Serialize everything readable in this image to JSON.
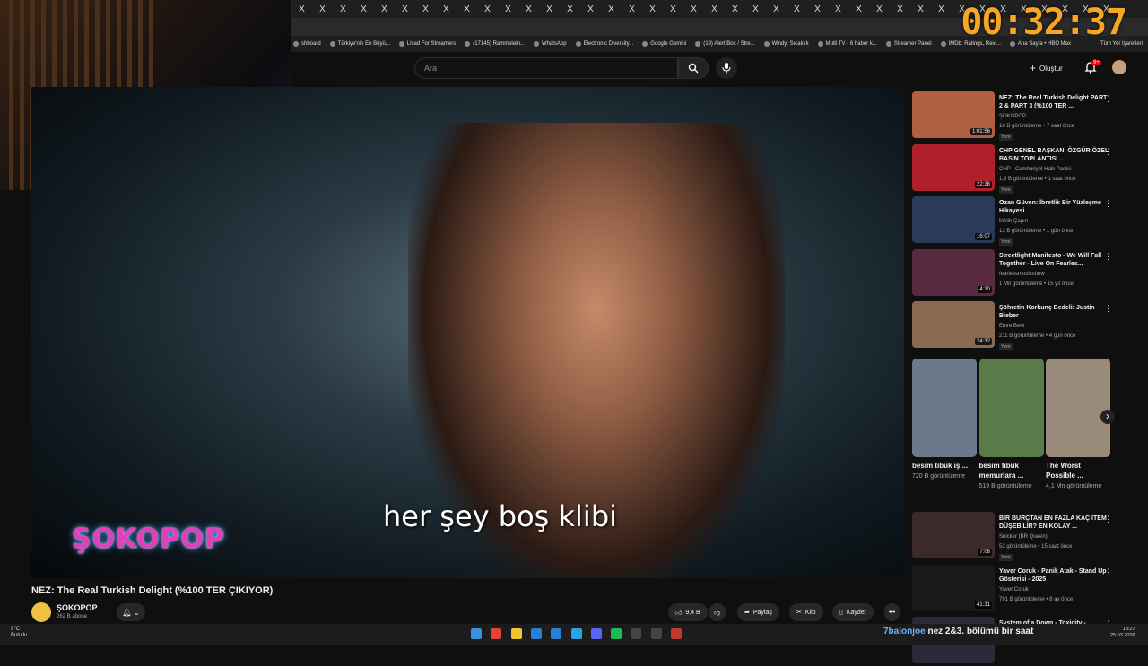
{
  "timer": "00:32:37",
  "tabs_close_glyph": "X",
  "bookmarks": [
    "shboard",
    "Türkiye'nin En Büyü...",
    "Livad For Streamers",
    "(17145) Rammstein...",
    "WhatsApp",
    "Electronic Diversity...",
    "Google Gemini",
    "(19) Alert Box / Stre...",
    "Windy: Sıcaklık",
    "Multi TV - 6 haber k...",
    "Streamer Panel",
    "IMDb: Ratings, Revi...",
    "Ana Sayfa • HBO Max"
  ],
  "bookmarks_all": "Tüm Yer İşaretleri",
  "header": {
    "search_placeholder": "Ara",
    "create_label": "Oluştur",
    "notif_badge": "9+"
  },
  "video": {
    "logo": "ŞOKOPOP",
    "subtitle": "her şey boş klibi"
  },
  "below": {
    "title": "NEZ: The Real Turkish Delight (%100 TER ÇIKIYOR)",
    "channel": "ŞOKOPOP",
    "subs": "262 B abone",
    "likes": "9,4 B",
    "share": "Paylaş",
    "clip": "Klip",
    "save": "Kaydet"
  },
  "sidebar": [
    {
      "title": "NEZ: The Real Turkish Delight PART 2 & PART 3 (%100 TER ...",
      "channel": "ŞOKOPOP",
      "stats": "18 B görüntüleme • 7 saat önce",
      "new": "Yeni",
      "duration": "1:01:56",
      "color": "#b06040"
    },
    {
      "title": "CHP GENEL BAŞKANI ÖZGÜR ÖZEL BASIN TOPLANTISI ...",
      "channel": "CHP - Cumhuriyet Halk Partisi",
      "stats": "1,9 B görüntüleme • 1 saat önce",
      "new": "Yeni",
      "duration": "22:38",
      "color": "#b0202a"
    },
    {
      "title": "Ozan Güven: İbretlik Bir Yüzleşme Hikayesi",
      "channel": "Melih Çapın",
      "stats": "12 B görüntüleme • 1 gün önce",
      "new": "Yeni",
      "duration": "16:07",
      "color": "#2a3a5a"
    },
    {
      "title": "Streetlight Manifesto - We Will Fall Together - Live On Fearles...",
      "channel": "fearlessmusicshow",
      "stats": "1 Mn görüntüleme • 15 yıl önce",
      "new": "",
      "duration": "4:30",
      "color": "#5a2a40"
    },
    {
      "title": "Şöhretin Korkunç Bedeli: Justin Bieber",
      "channel": "Emre Berk",
      "stats": "211 B görüntüleme • 4 gün önce",
      "new": "Yeni",
      "duration": "24:32",
      "color": "#8a6a50"
    }
  ],
  "shorts": [
    {
      "title": "besim tibuk iş ...",
      "views": "720 B görüntüleme",
      "color": "#6a7a8a"
    },
    {
      "title": "besim tibuk memurlara ...",
      "views": "519 B görüntüleme",
      "color": "#5a7a4a"
    },
    {
      "title": "The Worst Possible ...",
      "views": "4,1 Mn görüntüleme",
      "color": "#9a8a7a"
    }
  ],
  "sidebar2": [
    {
      "title": "BİR BURÇTAN EN FAZLA KAÇ İTEM DÜŞEBİLİR? EN KOLAY ...",
      "channel": "Snicker (BR Queen)",
      "stats": "52 görüntüleme • 15 saat önce",
      "new": "Yeni",
      "duration": "7:06",
      "color": "#3a2a2a"
    },
    {
      "title": "Yaver Coruk - Panik Atak - Stand Up Gösterisi - 2025",
      "channel": "Yaver Coruk",
      "stats": "791 B görüntüleme • 8 ay önce",
      "new": "",
      "duration": "41:31",
      "color": "#1a1a1a"
    },
    {
      "title": "System of a Down - Toxicity -",
      "channel": "",
      "stats": "",
      "new": "",
      "duration": "",
      "color": "#2a2a3a"
    }
  ],
  "taskbar": {
    "temp": "9°C",
    "weather": "Bulutlu",
    "ticker_user": "7balonjoe",
    "ticker_msg": "nez 2&3. bölümü bir saat",
    "time": "18:27",
    "date": "25.03.2026"
  }
}
